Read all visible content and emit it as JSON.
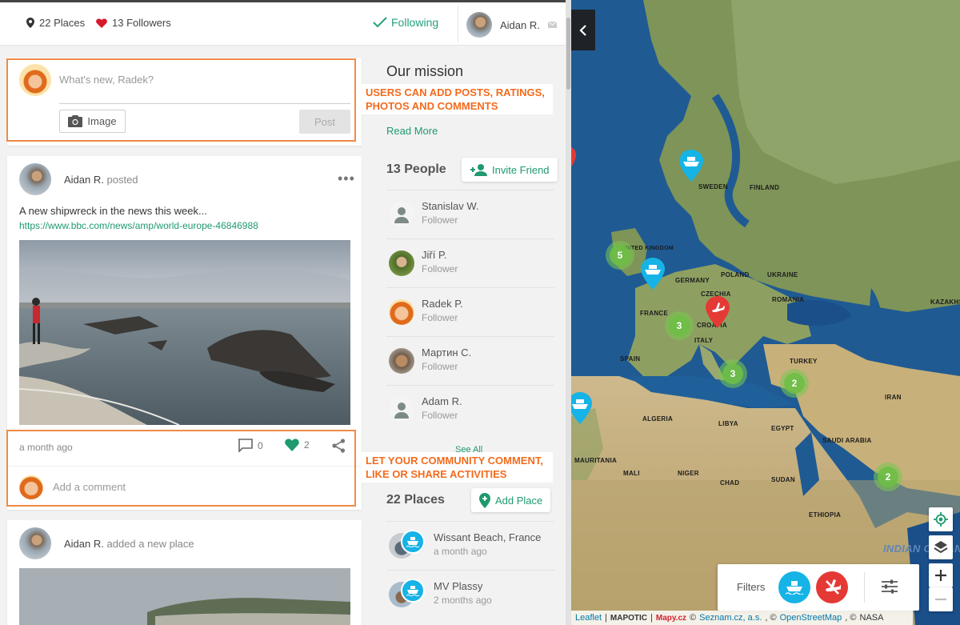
{
  "topbar": {
    "places": "22 Places",
    "followers": "13 Followers",
    "following": "Following",
    "user_name": "Aidan R."
  },
  "composer": {
    "placeholder": "What's new, Radek?",
    "image_label": "Image",
    "post_label": "Post"
  },
  "callouts": {
    "top": "USERS CAN ADD POSTS, RATINGS, PHOTOS AND COMMENTS",
    "bottom": "LET YOUR COMMUNITY COMMENT, LIKE OR SHARE ACTIVITIES"
  },
  "post1": {
    "author": "Aidan R.",
    "action": "posted",
    "text": "A new shipwreck in the news this week...",
    "link": "https://www.bbc.com/news/amp/world-europe-46846988",
    "time": "a month ago",
    "comments": "0",
    "likes": "2",
    "comment_placeholder": "Add a comment"
  },
  "post2": {
    "author": "Aidan R.",
    "action": "added a new place"
  },
  "sidebar": {
    "mission_title": "Our mission",
    "read_more": "Read More",
    "people_title": "13 People",
    "invite_label": "Invite Friend",
    "people": [
      {
        "name": "Stanislav W.",
        "role": "Follower"
      },
      {
        "name": "Jiří P.",
        "role": "Follower"
      },
      {
        "name": "Radek P.",
        "role": "Follower"
      },
      {
        "name": "Мартин С.",
        "role": "Follower"
      },
      {
        "name": "Adam R.",
        "role": "Follower"
      }
    ],
    "see_all": "See All",
    "places_title": "22 Places",
    "add_place_label": "Add Place",
    "places": [
      {
        "name": "Wissant Beach, France",
        "time": "a month ago"
      },
      {
        "name": "MV Plassy",
        "time": "2 months ago"
      }
    ]
  },
  "map": {
    "countries": [
      "SWEDEN",
      "FINLAND",
      "UNITED KINGDOM",
      "GERMANY",
      "POLAND",
      "CZECHIA",
      "UKRAINE",
      "FRANCE",
      "CROATIA",
      "ROMANIA",
      "ITALY",
      "SPAIN",
      "TURKEY",
      "KAZAKHS",
      "ALGERIA",
      "LIBYA",
      "EGYPT",
      "IRAN",
      "SAUDI ARABIA",
      "MAURITANIA",
      "MALI",
      "NIGER",
      "CHAD",
      "SUDAN",
      "ETHIOPIA",
      "INDIAN OCEAN"
    ],
    "clusters": [
      "5",
      "3",
      "3",
      "2",
      "2"
    ],
    "filters_label": "Filters",
    "attribution": {
      "leaflet": "Leaflet",
      "mapotic": "MAPOTIC",
      "mapy": "Mapy.cz",
      "seznam": "Seznam.cz, a.s.",
      "osm": "OpenStreetMap",
      "nasa": "NASA"
    }
  },
  "colors": {
    "accent": "#1f9a6e",
    "callout": "#f26b1d",
    "ship_pin": "#16b3e6",
    "plane_pin": "#e53935"
  }
}
